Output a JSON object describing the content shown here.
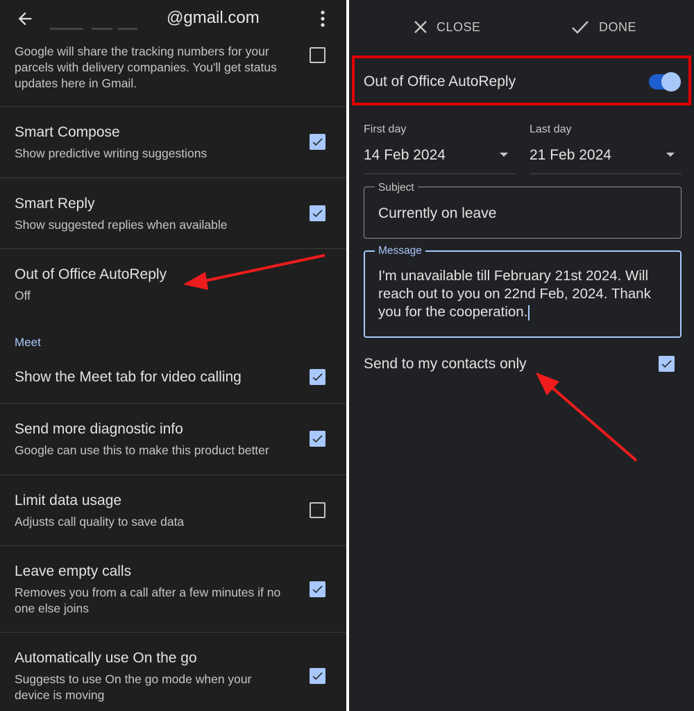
{
  "left": {
    "header": {
      "title": "@gmail.com"
    },
    "tracking_text": "Google will share the tracking numbers for your parcels with delivery companies. You'll get status updates here in Gmail.",
    "settings": [
      {
        "title": "Smart Compose",
        "subtitle": "Show predictive writing suggestions",
        "checked": true
      },
      {
        "title": "Smart Reply",
        "subtitle": "Show suggested replies when available",
        "checked": true
      },
      {
        "title": "Out of Office AutoReply",
        "subtitle": "Off"
      }
    ],
    "section_label": "Meet",
    "meet_settings": [
      {
        "title": "Show the Meet tab for video calling",
        "subtitle": "",
        "checked": true
      },
      {
        "title": "Send more diagnostic info",
        "subtitle": "Google can use this to make this product better",
        "checked": true
      },
      {
        "title": "Limit data usage",
        "subtitle": "Adjusts call quality to save data",
        "checked": false
      },
      {
        "title": "Leave empty calls",
        "subtitle": "Removes you from a call after a few minutes if no one else joins",
        "checked": true
      },
      {
        "title": "Automatically use On the go",
        "subtitle": "Suggests to use On the go mode when your device is moving",
        "checked": true
      }
    ]
  },
  "right": {
    "toolbar": {
      "close_label": "CLOSE",
      "done_label": "DONE"
    },
    "autoreply": {
      "label": "Out of Office AutoReply",
      "enabled": true
    },
    "first_day": {
      "caption": "First day",
      "value": "14 Feb 2024"
    },
    "last_day": {
      "caption": "Last day",
      "value": "21 Feb 2024"
    },
    "subject": {
      "legend": "Subject",
      "value": "Currently on leave"
    },
    "message": {
      "legend": "Message",
      "value": "I'm unavailable till February 21st 2024. Will reach out to you on 22nd Feb, 2024. Thank you for the cooperation."
    },
    "contacts_only": {
      "label": "Send to my contacts only",
      "checked": true
    }
  },
  "colors": {
    "highlight": "#e00000",
    "accent": "#a8c7fa",
    "arrow": "#ee1c1c"
  }
}
